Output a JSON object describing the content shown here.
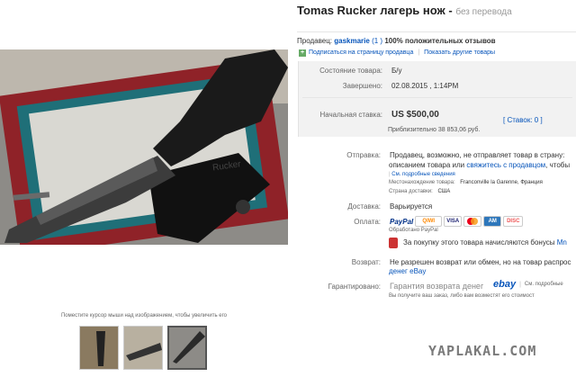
{
  "title": {
    "main": "Tomas Rucker лагерь нож -",
    "sub": "без перевода"
  },
  "seller": {
    "label": "Продавец:",
    "name": "gaskmarie",
    "count": "(1 )",
    "feedback": "100% положительных отзывов",
    "follow": "Подписаться на страницу продавца",
    "separator": "|",
    "other_items": "Показать другие товары"
  },
  "details": {
    "condition_label": "Состояние товара:",
    "condition_value": "Б/у",
    "ended_label": "Завершено:",
    "ended_value": "02.08.2015 , 1:14PM",
    "start_bid_label": "Начальная ставка:",
    "price": "US $500,00",
    "price_converted": "Приблизительно 38 853,06 руб.",
    "bids": "[ Ставок: 0 ]"
  },
  "shipping": {
    "label": "Отправка:",
    "line1": "Продавец, возможно, не отправляет товар в страну:",
    "line2_a": "описанием товара или",
    "line2_link": "свяжитесь с продавцом",
    "line2_b": ", чтобы",
    "more_link": "См. подробные сведения",
    "location_label": "Местонахождение товара:",
    "location_value": "Franconville la Garenne, Франция",
    "countries_label": "Страна доставки:",
    "countries_value": "США"
  },
  "delivery": {
    "label": "Доставка:",
    "value": "Варьируется"
  },
  "payment": {
    "label": "Оплата:",
    "methods": [
      "PayPal",
      "QIWI",
      "VISA",
      "MC",
      "AMEX",
      "DISCOVER"
    ],
    "processed": "Обработано PayPal",
    "bonus": "За покупку этого товара начисляются бонусы",
    "bonus_link": "Mn"
  },
  "returns": {
    "label": "Возврат:",
    "line1": "Не разрешен возврат или обмен, но на товар распрос",
    "line2": "денег eBay"
  },
  "guarantee": {
    "label": "Гарантировано:",
    "value": "Гарантия возврата денег",
    "brand": "ebay",
    "separator": "|",
    "more": "См. подробные",
    "note": "Вы получите ваш заказ, либо вам возместят его стоимост"
  },
  "photo": {
    "hint": "Поместите курсор мыши над изображением, чтобы увеличить его",
    "box_text": "Rucker"
  },
  "watermark": "YAPLAKAL.COM",
  "colors": {
    "link": "#0654ba",
    "box_bg": "#f2f2f2",
    "paypal": "#003087"
  }
}
